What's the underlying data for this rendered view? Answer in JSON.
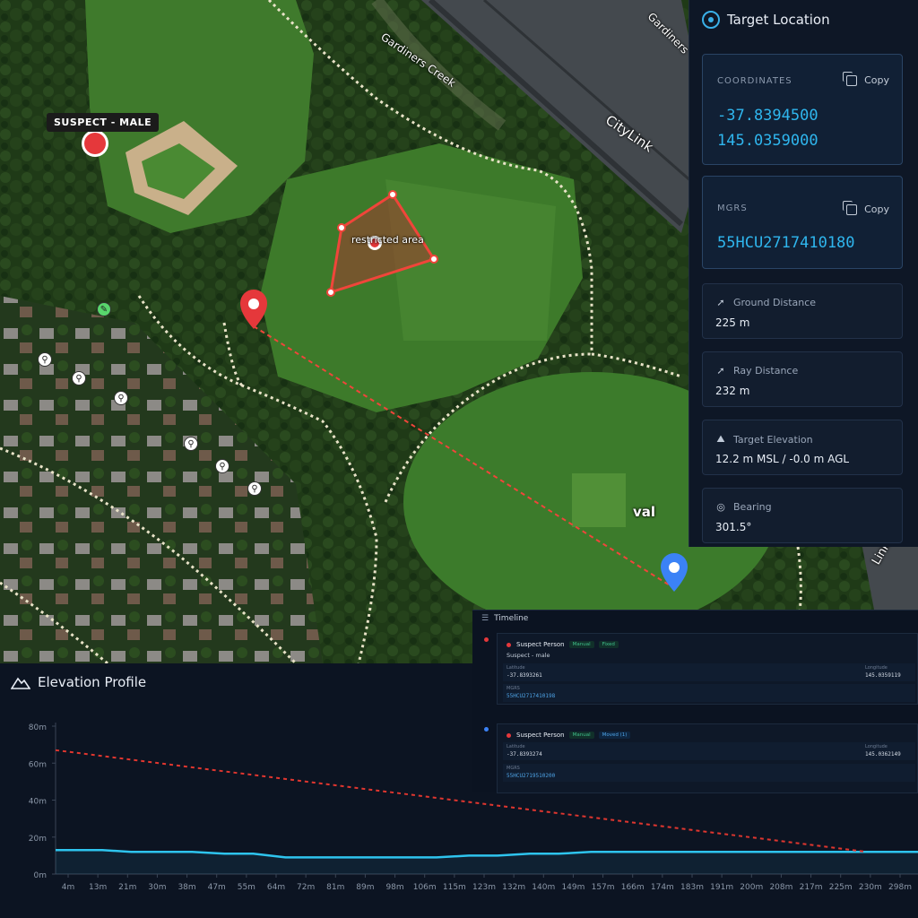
{
  "map": {
    "suspect_label": "SUSPECT - MALE",
    "restricted_label": "restricted area",
    "road_labels": {
      "creek": "Gardiners Creek",
      "citylink": "CityLink",
      "gardiners": "Gardiners",
      "oval": "val",
      "link": "Link"
    }
  },
  "target_panel": {
    "title": "Target Location",
    "coordinates": {
      "label": "COORDINATES",
      "copy": "Copy",
      "lat": "-37.8394500",
      "lon": "145.0359000"
    },
    "mgrs": {
      "label": "MGRS",
      "copy": "Copy",
      "value": "55HCU2717410180"
    },
    "ground_distance": {
      "label": "Ground Distance",
      "value": "225 m"
    },
    "ray_distance": {
      "label": "Ray Distance",
      "value": "232 m"
    },
    "target_elevation": {
      "label": "Target Elevation",
      "value": "12.2 m MSL / -0.0 m AGL"
    },
    "bearing": {
      "label": "Bearing",
      "value": "301.5°"
    }
  },
  "timeline": {
    "title": "Timeline",
    "events": [
      {
        "title": "Suspect Person",
        "badge1": "Manual",
        "badge2": "Fixed",
        "subtitle": "Suspect - male",
        "lat_label": "Latitude",
        "lat": "-37.8393261",
        "lon_label": "Longitude",
        "lon": "145.0359119",
        "mgrs_label": "MGRS",
        "mgrs": "55HCU2717410198"
      },
      {
        "title": "Suspect Person",
        "badge1": "Manual",
        "badge2": "Moved (1)",
        "lat_label": "Latitude",
        "lat": "-37.8393274",
        "lon_label": "Longitude",
        "lon": "145.0362149",
        "mgrs_label": "MGRS",
        "mgrs": "55HCU2719510200"
      }
    ]
  },
  "elevation": {
    "title": "Elevation Profile",
    "colors": {
      "terrain": "#2ec4ee",
      "sightline": "#e0362f"
    }
  },
  "chart_data": {
    "type": "line",
    "title": "Elevation Profile",
    "xlabel": "",
    "ylabel": "",
    "x_tick_labels": [
      "4m",
      "13m",
      "21m",
      "30m",
      "38m",
      "47m",
      "55m",
      "64m",
      "72m",
      "81m",
      "89m",
      "98m",
      "106m",
      "115m",
      "123m",
      "132m",
      "140m",
      "149m",
      "157m",
      "166m",
      "174m",
      "183m",
      "191m",
      "200m",
      "208m",
      "217m",
      "225m",
      "230m",
      "298m"
    ],
    "y_tick_labels": [
      "80m",
      "60m",
      "40m",
      "20m",
      "0m"
    ],
    "ylim": [
      0,
      80
    ],
    "series": [
      {
        "x": [
          0,
          4,
          13,
          21,
          30,
          38,
          47,
          55,
          64,
          72,
          81,
          89,
          98,
          106,
          115,
          123,
          132,
          140,
          149,
          157,
          166,
          174,
          183,
          191,
          200,
          208,
          217,
          225,
          230,
          240
        ],
        "values": [
          13,
          13,
          13,
          12,
          12,
          12,
          11,
          11,
          9,
          9,
          9,
          9,
          9,
          9,
          10,
          10,
          11,
          11,
          12,
          12,
          12,
          12,
          12,
          12,
          12,
          12,
          12,
          12,
          12,
          12
        ]
      },
      {
        "x": [
          0,
          225
        ],
        "values": [
          67,
          12.2
        ]
      }
    ],
    "grid": false
  }
}
